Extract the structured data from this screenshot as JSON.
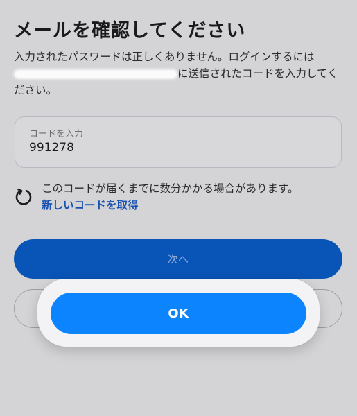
{
  "page": {
    "title": "メールを確認してください",
    "description_part1": "入力されたパスワードは正しくありません。ログインするには",
    "description_part2": "に送信されたコードを入力してください。"
  },
  "code_input": {
    "label": "コードを入力",
    "value": "991278"
  },
  "notice": {
    "text": "このコードが届くまでに数分かかる場合があります。",
    "link_label": "新しいコードを取得"
  },
  "buttons": {
    "next_label": "次へ"
  },
  "alert": {
    "ok_label": "OK"
  },
  "colors": {
    "primary": "#0954b7",
    "link": "#1852b0",
    "alert_button": "#0b84fe"
  },
  "icons": {
    "refresh": "refresh-icon"
  }
}
